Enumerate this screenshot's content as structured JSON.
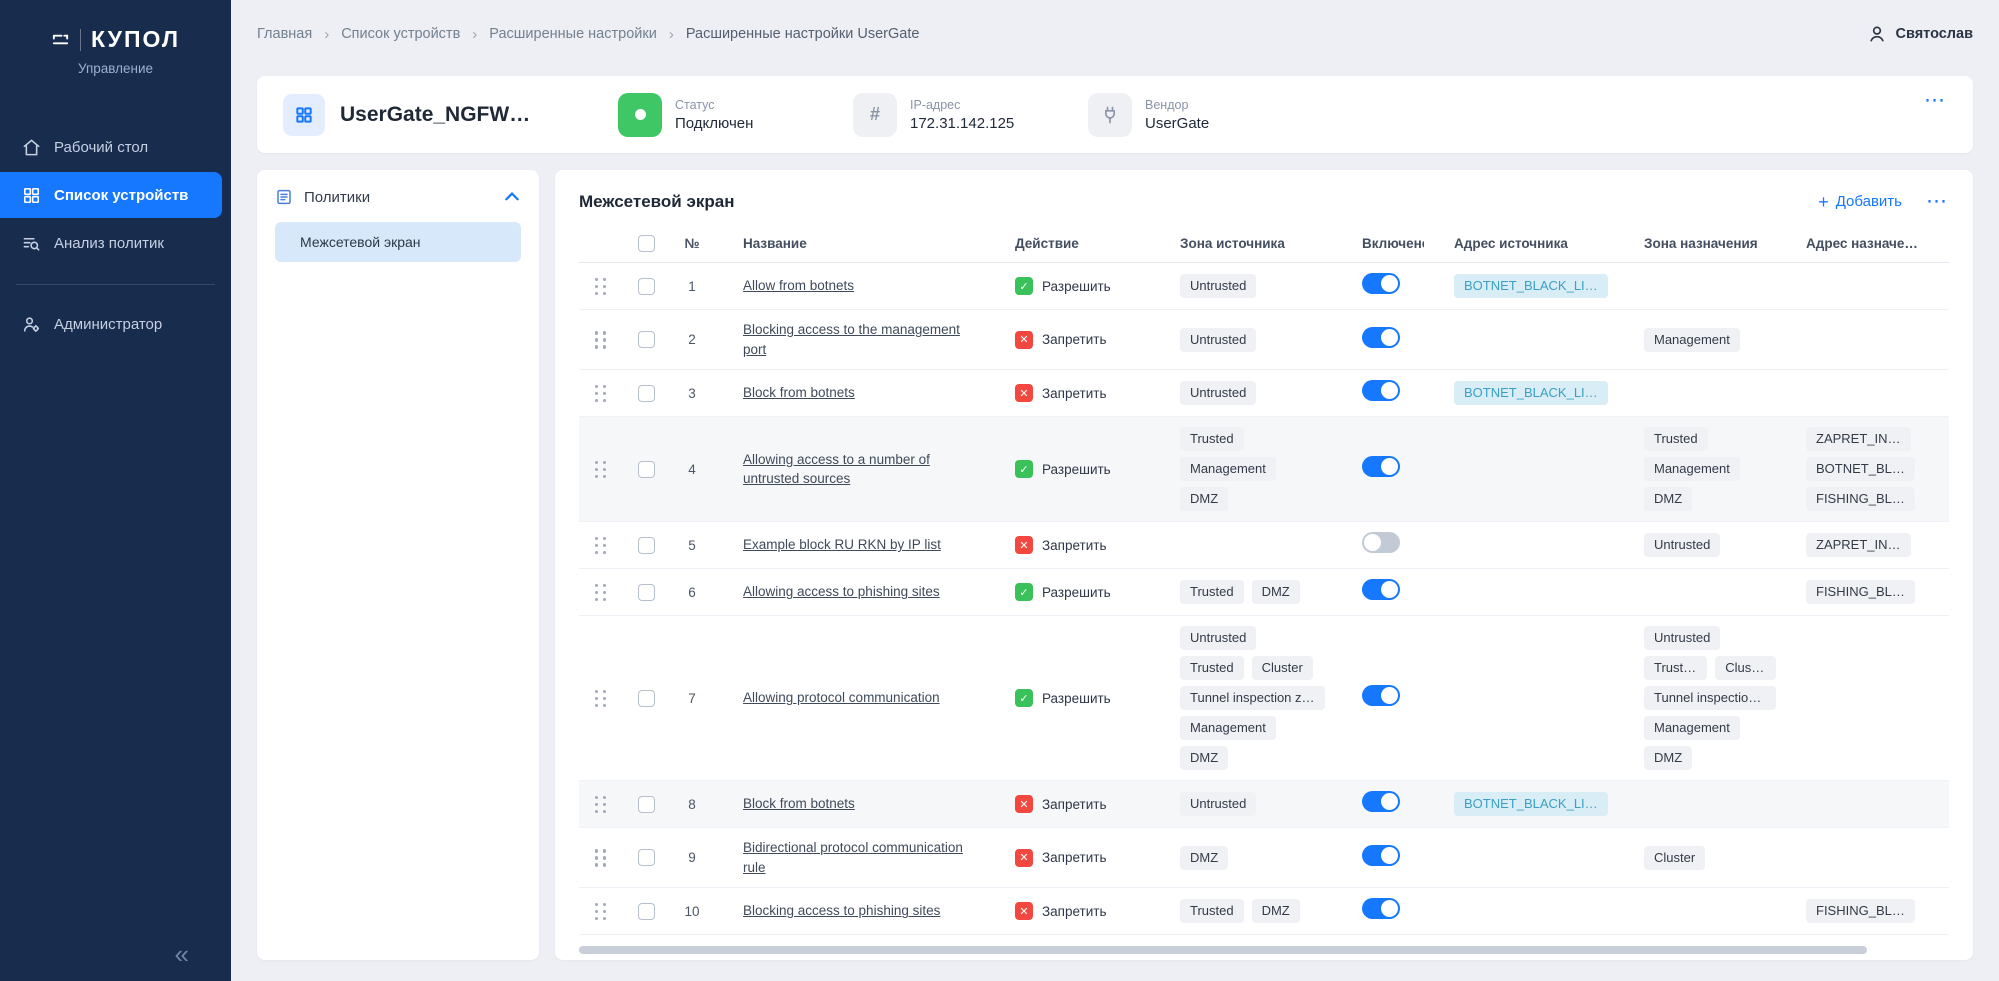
{
  "colors": {
    "accent": "#1677ff",
    "allow_green": "#3bc159",
    "deny_red": "#f2483f",
    "status_green": "#3ec764",
    "sidebar_bg": "#182c4e"
  },
  "icons": {
    "more": "⋯",
    "plus": "+",
    "collapse": "«",
    "breadcrumb_sep": "›",
    "hash": "#"
  },
  "sidebar": {
    "logo_text": "КУПОЛ",
    "subtitle": "Управление",
    "items": [
      {
        "label": "Рабочий стол"
      },
      {
        "label": "Список устройств"
      },
      {
        "label": "Анализ политик"
      },
      {
        "label": "Администратор"
      }
    ]
  },
  "header": {
    "breadcrumbs": [
      "Главная",
      "Список устройств",
      "Расширенные настройки",
      "Расширенные настройки UserGate"
    ],
    "user_name": "Святослав"
  },
  "device_card": {
    "title": "UserGate_NGFW…",
    "status": {
      "label": "Статус",
      "value": "Подключен"
    },
    "ip": {
      "label": "IP-адрес",
      "value": "172.31.142.125"
    },
    "vendor": {
      "label": "Вендор",
      "value": "UserGate"
    }
  },
  "policies_panel": {
    "title": "Политики",
    "items": [
      {
        "label": "Межсетевой экран",
        "selected": true
      }
    ]
  },
  "firewall_panel": {
    "title": "Межсетевой экран",
    "add_button": "Добавить",
    "columns": [
      "№",
      "Название",
      "Действие",
      "Зона источника",
      "Включено",
      "Адрес источника",
      "Зона назначения",
      "Адрес назначения"
    ],
    "action_labels": {
      "allow": "Разрешить",
      "deny": "Запретить"
    },
    "rows": [
      {
        "num": 1,
        "name": "Allow from botnets",
        "action": "allow",
        "enabled": true,
        "src_zones": [
          [
            "Untrusted"
          ]
        ],
        "src_addresses": [
          "BOTNET_BLACK_LI…"
        ],
        "dst_zones": [],
        "dst_addresses": []
      },
      {
        "num": 2,
        "name": "Blocking access to the management port",
        "action": "deny",
        "enabled": true,
        "src_zones": [
          [
            "Untrusted"
          ]
        ],
        "src_addresses": [],
        "dst_zones": [
          [
            "Management"
          ]
        ],
        "dst_addresses": []
      },
      {
        "num": 3,
        "name": "Block from botnets",
        "action": "deny",
        "enabled": true,
        "src_zones": [
          [
            "Untrusted"
          ]
        ],
        "src_addresses": [
          "BOTNET_BLACK_LI…"
        ],
        "dst_zones": [],
        "dst_addresses": []
      },
      {
        "num": 4,
        "name": "Allowing access to a number of untrusted sources",
        "action": "allow",
        "enabled": true,
        "shaded": true,
        "src_zones": [
          [
            "Trusted"
          ],
          [
            "Management"
          ],
          [
            "DMZ"
          ]
        ],
        "src_addresses": [],
        "dst_zones": [
          [
            "Trusted"
          ],
          [
            "Management"
          ],
          [
            "DMZ"
          ]
        ],
        "dst_addresses": [
          "ZAPRET_IN…",
          "BOTNET_BL…",
          "FISHING_BL…"
        ]
      },
      {
        "num": 5,
        "name": "Example block RU RKN by IP list",
        "action": "deny",
        "enabled": false,
        "src_zones": [],
        "src_addresses": [],
        "dst_zones": [
          [
            "Untrusted"
          ]
        ],
        "dst_addresses": [
          "ZAPRET_IN…"
        ]
      },
      {
        "num": 6,
        "name": "Allowing access to phishing sites",
        "action": "allow",
        "enabled": true,
        "src_zones": [
          [
            "Trusted",
            "DMZ"
          ]
        ],
        "src_addresses": [],
        "dst_zones": [],
        "dst_addresses": [
          "FISHING_BL…"
        ]
      },
      {
        "num": 7,
        "name": "Allowing protocol communication",
        "action": "allow",
        "enabled": true,
        "src_zones": [
          [
            "Untrusted"
          ],
          [
            "Trusted",
            "Cluster"
          ],
          [
            "Tunnel inspection z…"
          ],
          [
            "Management"
          ],
          [
            "DMZ"
          ]
        ],
        "src_addresses": [],
        "dst_zones": [
          [
            "Untrusted"
          ],
          [
            "Trusted",
            "Cluster"
          ],
          [
            "Tunnel inspection z…"
          ],
          [
            "Management"
          ],
          [
            "DMZ"
          ]
        ],
        "dst_addresses": []
      },
      {
        "num": 8,
        "name": "Block from botnets",
        "action": "deny",
        "enabled": true,
        "shaded": true,
        "src_zones": [
          [
            "Untrusted"
          ]
        ],
        "src_addresses": [
          "BOTNET_BLACK_LI…"
        ],
        "dst_zones": [],
        "dst_addresses": []
      },
      {
        "num": 9,
        "name": "Bidirectional protocol communication rule",
        "action": "deny",
        "enabled": true,
        "src_zones": [
          [
            "DMZ"
          ]
        ],
        "src_addresses": [],
        "dst_zones": [
          [
            "Cluster"
          ]
        ],
        "dst_addresses": []
      },
      {
        "num": 10,
        "name": "Blocking access to phishing sites",
        "action": "deny",
        "enabled": true,
        "src_zones": [
          [
            "Trusted",
            "DMZ"
          ]
        ],
        "src_addresses": [],
        "dst_zones": [],
        "dst_addresses": [
          "FISHING_BL…"
        ]
      }
    ]
  }
}
